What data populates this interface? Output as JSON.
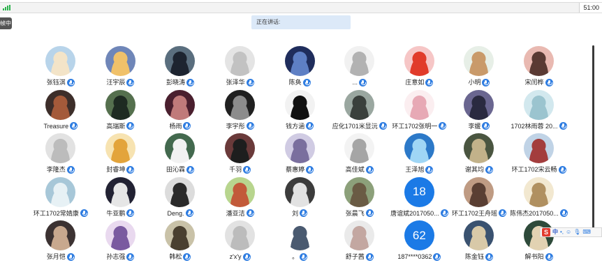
{
  "status_bar": {
    "clock": "51:00"
  },
  "side_tab": {
    "label": "帧中"
  },
  "speaking": {
    "label": "正在讲话:"
  },
  "ime": {
    "logo": "S",
    "lang": "中",
    "punct": "•,",
    "emoji": "☺",
    "voice": "🎙",
    "keyboard": "⌨"
  },
  "colors": {
    "accent": "#2f7de1",
    "speaking_bg": "#dce9f8",
    "signal": "#2bb24c"
  },
  "participants": [
    {
      "name": "张钰淇",
      "bg": "#b8d4ea",
      "fg": "#f3e4c8"
    },
    {
      "name": "汪宇辰",
      "bg": "#6f86b8",
      "fg": "#f0c16a"
    },
    {
      "name": "彭晓涛",
      "bg": "#5a6e7e",
      "fg": "#1d2430"
    },
    {
      "name": "张泽华",
      "bg": "#e4e4e4",
      "fg": "#c2c2c2"
    },
    {
      "name": "陈奂",
      "bg": "#1f2d5c",
      "fg": "#5e7fc4"
    },
    {
      "name": "...",
      "bg": "#f1f1f1",
      "fg": "#b2b2b2"
    },
    {
      "name": "庄意如",
      "bg": "#f6c6c6",
      "fg": "#e13b2a"
    },
    {
      "name": "小明",
      "bg": "#e7efe7",
      "fg": "#c99a6a"
    },
    {
      "name": "宋闰桦",
      "bg": "#e9b9b1",
      "fg": "#5a3a33"
    },
    {
      "name": "Treasure",
      "bg": "#3d2e2a",
      "fg": "#a45a3a"
    },
    {
      "name": "高瑞斯",
      "bg": "#55704e",
      "fg": "#1e2b22"
    },
    {
      "name": "杨雨",
      "bg": "#4a1f2e",
      "fg": "#c07a7a"
    },
    {
      "name": "李宇彤",
      "bg": "#202020",
      "fg": "#8c8c8c"
    },
    {
      "name": "钱方涵",
      "bg": "#f2f2f2",
      "fg": "#111111"
    },
    {
      "name": "应化1701米显沅",
      "bg": "#9aa7a0",
      "fg": "#3a403c"
    },
    {
      "name": "环工1702张明一",
      "bg": "#fbeef0",
      "fg": "#e7a9b5"
    },
    {
      "name": "李媛",
      "bg": "#6a6690",
      "fg": "#2a2a40"
    },
    {
      "name": "1702林雨蓉 20...",
      "bg": "#d2e8ee",
      "fg": "#9bc4cf"
    },
    {
      "name": "李隆杰",
      "bg": "#e2e2e2",
      "fg": "#bcbcbc"
    },
    {
      "name": "封睿坤",
      "bg": "#f7e3b1",
      "fg": "#e3a43b"
    },
    {
      "name": "田沁霖",
      "bg": "#43694e",
      "fg": "#f2f2f2"
    },
    {
      "name": "千羽",
      "bg": "#6a3a3a",
      "fg": "#1e1e1e"
    },
    {
      "name": "蔡惠婷",
      "bg": "#d0cbe3",
      "fg": "#7a6f9e"
    },
    {
      "name": "高佳斌",
      "bg": "#f3f3f3",
      "fg": "#a5a5a5"
    },
    {
      "name": "王泽旭",
      "bg": "#2c79c8",
      "fg": "#9fd6f5"
    },
    {
      "name": "谢其均",
      "bg": "#4a5540",
      "fg": "#c2b28a"
    },
    {
      "name": "环工1702宋云畅",
      "bg": "#c0d3e6",
      "fg": "#a33d3d"
    },
    {
      "name": "环工1702常婧康",
      "bg": "#a7c7d8",
      "fg": "#e7f1f5"
    },
    {
      "name": "牛亚鹏",
      "bg": "#222233",
      "fg": "#e6e6e6"
    },
    {
      "name": "Deng.",
      "bg": "#dcdcdc",
      "fg": "#2a2a2a"
    },
    {
      "name": "潘亚洁",
      "bg": "#b8d58e",
      "fg": "#c25a3a"
    },
    {
      "name": "刘",
      "bg": "#3c3c3c",
      "fg": "#e2e2e2"
    },
    {
      "name": "张晨飞",
      "bg": "#8ca07a",
      "fg": "#6a5b44"
    },
    {
      "name": "唐谊斌2017050...",
      "number": "18",
      "bg": "#1b7ae6"
    },
    {
      "name": "环工1702王舟瑶",
      "bg": "#bf9b83",
      "fg": "#5a3f33"
    },
    {
      "name": "陈伟杰2017050...",
      "bg": "#f2e8d0",
      "fg": "#b09060"
    },
    {
      "name": "张月恺",
      "bg": "#3c3232",
      "fg": "#c8a88e"
    },
    {
      "name": "孙志强",
      "bg": "#e9d9ef",
      "fg": "#7a5aa0"
    },
    {
      "name": "韩松",
      "bg": "#c9c2a8",
      "fg": "#4a4030"
    },
    {
      "name": "z'x'y",
      "bg": "#e2e2e2",
      "fg": "#bcbcbc"
    },
    {
      "name": "。",
      "bg": "#ffffff",
      "fg": "#4a5a70"
    },
    {
      "name": "舒子茜",
      "bg": "#eaeaea",
      "fg": "#c3a7a1"
    },
    {
      "name": "187****0362",
      "number": "62",
      "bg": "#1b7ae6"
    },
    {
      "name": "陈金钰",
      "bg": "#3a5270",
      "fg": "#d8c9a8"
    },
    {
      "name": "解书阳",
      "bg": "#2e4a3a",
      "fg": "#e2d2b2"
    }
  ]
}
